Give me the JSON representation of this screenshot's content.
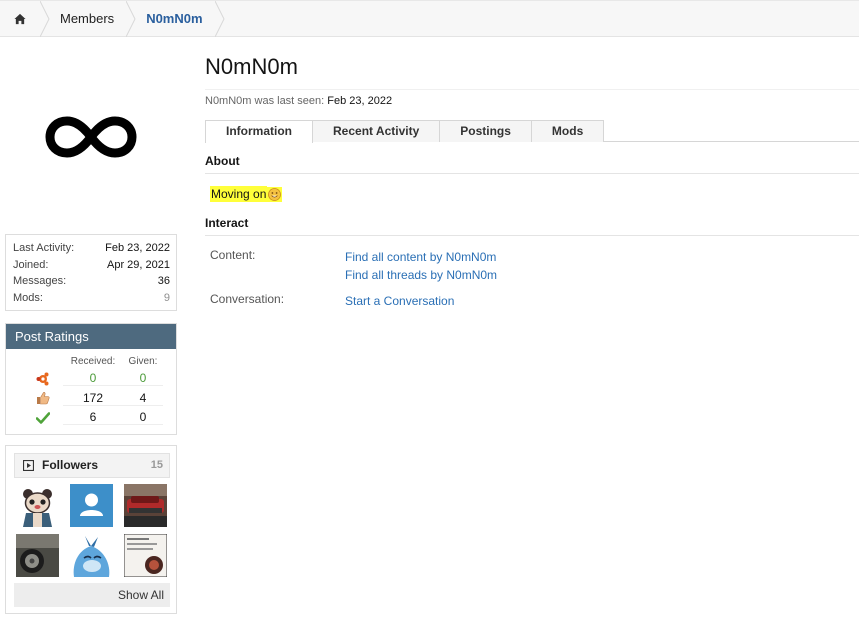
{
  "breadcrumb": {
    "home_icon": "home-icon",
    "items": [
      "Members",
      "N0mN0m"
    ]
  },
  "profile": {
    "username": "N0mN0m",
    "last_seen_prefix": "N0mN0m was last seen:",
    "last_seen_date": "Feb 23, 2022",
    "avatar_icon": "infinity-icon"
  },
  "stats": [
    {
      "label": "Last Activity:",
      "value": "Feb 23, 2022"
    },
    {
      "label": "Joined:",
      "value": "Apr 29, 2021"
    },
    {
      "label": "Messages:",
      "value": "36"
    },
    {
      "label": "Mods:",
      "value": "9"
    }
  ],
  "ratings": {
    "title": "Post Ratings",
    "col_received": "Received:",
    "col_given": "Given:",
    "rows": [
      {
        "icon": "network-share-icon",
        "received": "0",
        "given": "0"
      },
      {
        "icon": "thumbs-up-icon",
        "received": "172",
        "given": "4"
      },
      {
        "icon": "checkmark-icon",
        "received": "6",
        "given": "0"
      }
    ]
  },
  "followers": {
    "title": "Followers",
    "count": "15",
    "show_all": "Show All"
  },
  "tabs": [
    "Information",
    "Recent Activity",
    "Postings",
    "Mods"
  ],
  "about": {
    "title": "About",
    "text": "Moving on",
    "emoji_icon": "smiley-icon"
  },
  "interact": {
    "title": "Interact",
    "content_label": "Content:",
    "content_links": [
      "Find all content by N0mN0m",
      "Find all threads by N0mN0m"
    ],
    "conversation_label": "Conversation:",
    "conversation_link": "Start a Conversation"
  },
  "colors": {
    "accent_link": "#2a6fb5",
    "ratings_header": "#4e6a7f",
    "highlight": "#ffff3a",
    "positive": "#4a9a38"
  }
}
